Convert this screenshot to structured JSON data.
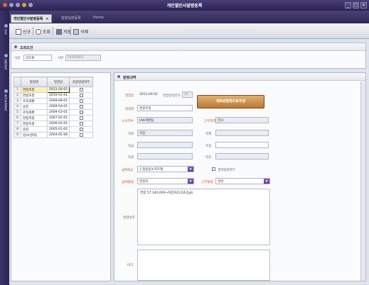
{
  "window": {
    "title": "개인별인사발령등록"
  },
  "left_nav": {
    "items": [
      "인사",
      "급여관리",
      "복리후생관리"
    ]
  },
  "tabs": [
    {
      "label": "개인별인사발령등록",
      "active": true
    },
    {
      "label": "발령일괄등록",
      "active": false
    },
    {
      "label": "Home",
      "active": false
    }
  ],
  "toolbar": {
    "new": "신규",
    "search": "조회",
    "save": "저장",
    "delete": "삭제"
  },
  "search": {
    "title": "조회조건",
    "employee_label": "사원",
    "employee_name": "강도환",
    "empno_label": "사번",
    "empno_value": "04050601"
  },
  "list": {
    "headers": [
      "발령명",
      "발령일",
      "최종발령여부"
    ],
    "rows": [
      {
        "no": "1",
        "name": "연봉조정",
        "date": "2011-04-01"
      },
      {
        "no": "2",
        "name": "연봉조정",
        "date": "2010-01-01"
      },
      {
        "no": "3",
        "name": "조직개편",
        "date": "2009-08-01"
      },
      {
        "no": "4",
        "name": "승진",
        "date": "2009-04-01"
      },
      {
        "no": "5",
        "name": "조직개편",
        "date": "2009-03-01"
      },
      {
        "no": "6",
        "name": "연봉조정",
        "date": "2007-02-01"
      },
      {
        "no": "7",
        "name": "연봉조정",
        "date": "2006-02-01"
      },
      {
        "no": "8",
        "name": "승진",
        "date": "2005-01-02"
      },
      {
        "no": "9",
        "name": "입사(경력)",
        "date": "2004-05-06"
      }
    ]
  },
  "detail": {
    "title": "발령내역",
    "date_label": "발령일",
    "date_value": "2011-04-01",
    "seq_label": "발령일련번호",
    "seq_value": "10",
    "save_new_button": "새로운발령으로저장",
    "name_label": "발령명",
    "name_value": "연봉조정",
    "dept_label": "소속부서",
    "dept_value": "HW개발팀",
    "work_label": "근무지역",
    "work_value": "전사",
    "rank_label": "직위",
    "rank_value": "차장",
    "duty_label": "직책",
    "duty_value": "",
    "grade_label": "직급",
    "grade_value": "",
    "step_label": "호봉",
    "step_value": "",
    "class_label": "직종",
    "class_value": "",
    "type_label": "직유",
    "type_value": "",
    "pay_class_label": "급여직군",
    "pay_class_value": "1.정링링소프트웨",
    "concurrent_label": "겸직발령여부",
    "pay_type_label": "급여형태",
    "pay_type_value": "연봉직",
    "work_type_label": "근무형태",
    "work_type_value": "일반",
    "content_label": "발령내역",
    "content_value": "연봉 57,340,000→차장3년(고효승급)",
    "remark_label": "비고",
    "remark_value": ""
  }
}
